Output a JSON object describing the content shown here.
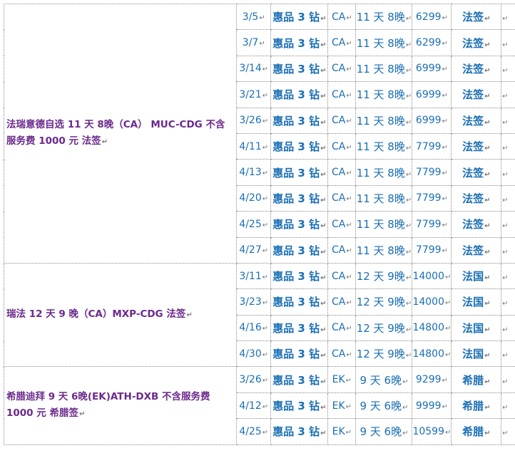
{
  "return_mark": "↵",
  "groups": [
    {
      "title": "法瑞意德自选 11 天 8晚（CA） MUC-CDG 不含服务费 1000 元 法签",
      "rows": [
        {
          "date": "3/5",
          "package": "惠品 3 钻",
          "airline": "CA",
          "nights": "11 天 8晚",
          "price": "6299",
          "visa": "法签"
        },
        {
          "date": "3/7",
          "package": "惠品 3 钻",
          "airline": "CA",
          "nights": "11 天 8晚",
          "price": "6299",
          "visa": "法签"
        },
        {
          "date": "3/14",
          "package": "惠品 3 钻",
          "airline": "CA",
          "nights": "11 天 8晚",
          "price": "6999",
          "visa": "法签"
        },
        {
          "date": "3/21",
          "package": "惠品 3 钻",
          "airline": "CA",
          "nights": "11 天 8晚",
          "price": "6999",
          "visa": "法签"
        },
        {
          "date": "3/26",
          "package": "惠品 3 钻",
          "airline": "CA",
          "nights": "11 天 8晚",
          "price": "6999",
          "visa": "法签"
        },
        {
          "date": "4/11",
          "package": "惠品 3 钻",
          "airline": "CA",
          "nights": "11 天 8晚",
          "price": "7799",
          "visa": "法签"
        },
        {
          "date": "4/13",
          "package": "惠品 3 钻",
          "airline": "CA",
          "nights": "11 天 8晚",
          "price": "7799",
          "visa": "法签"
        },
        {
          "date": "4/20",
          "package": "惠品 3 钻",
          "airline": "CA",
          "nights": "11 天 8晚",
          "price": "7799",
          "visa": "法签"
        },
        {
          "date": "4/25",
          "package": "惠品 3 钻",
          "airline": "CA",
          "nights": "11 天 8晚",
          "price": "7799",
          "visa": "法签"
        },
        {
          "date": "4/27",
          "package": "惠品 3 钻",
          "airline": "CA",
          "nights": "11 天 8晚",
          "price": "7799",
          "visa": "法签"
        }
      ]
    },
    {
      "title": "瑞法 12 天 9 晚（CA）MXP-CDG 法签",
      "rows": [
        {
          "date": "3/11",
          "package": "惠品 3 钻",
          "airline": "CA",
          "nights": "12 天 9晚",
          "price": "14000",
          "visa": "法国"
        },
        {
          "date": "3/23",
          "package": "惠品 3 钻",
          "airline": "CA",
          "nights": "12 天 9晚",
          "price": "14000",
          "visa": "法国"
        },
        {
          "date": "4/16",
          "package": "惠品 3 钻",
          "airline": "CA",
          "nights": "12 天 9晚",
          "price": "14800",
          "visa": "法国"
        },
        {
          "date": "4/30",
          "package": "惠品 3 钻",
          "airline": "CA",
          "nights": "12 天 9晚",
          "price": "14800",
          "visa": "法国"
        }
      ]
    },
    {
      "title": "希腊迪拜 9 天 6晚(EK)ATH-DXB 不含服务费 1000 元 希腊签",
      "rows": [
        {
          "date": "3/26",
          "package": "惠品 3 钻",
          "airline": "EK",
          "nights": "9 天 6晚",
          "price": "9299",
          "visa": "希腊"
        },
        {
          "date": "4/12",
          "package": "惠品 3 钻",
          "airline": "EK",
          "nights": "9 天 6晚",
          "price": "9999",
          "visa": "希腊"
        },
        {
          "date": "4/25",
          "package": "惠品 3 钻",
          "airline": "EK",
          "nights": "9 天 6晚",
          "price": "10599",
          "visa": "希腊"
        }
      ]
    }
  ]
}
